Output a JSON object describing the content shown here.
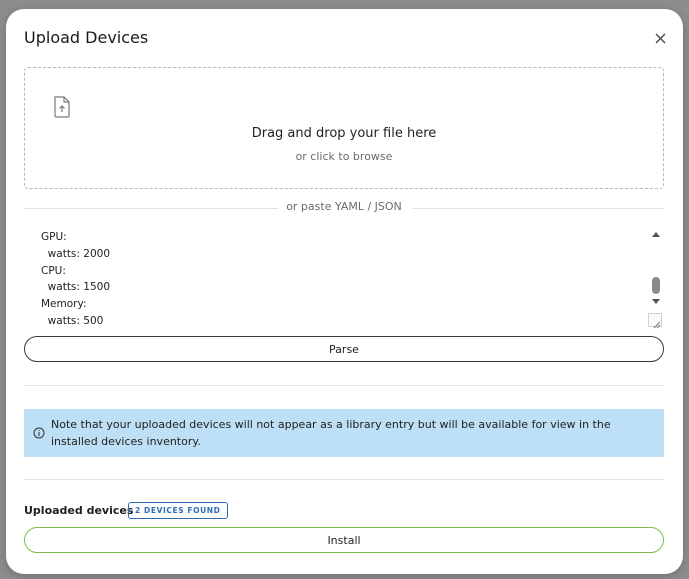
{
  "modal": {
    "title": "Upload Devices",
    "close_icon": "close-icon"
  },
  "dropzone": {
    "icon": "file-upload-icon",
    "main_text": "Drag and drop your file here",
    "sub_text": "or click to browse"
  },
  "divider": {
    "text": "or paste YAML / JSON"
  },
  "editor": {
    "lines": [
      "GPU:",
      "  watts: 2000",
      "CPU:",
      "  watts: 1500",
      "Memory:",
      "  watts: 500"
    ]
  },
  "actions": {
    "parse_label": "Parse",
    "install_label": "Install"
  },
  "notice": {
    "icon": "info-icon",
    "text": "Note that your uploaded devices will not appear as a library entry but will be available for view in the installed devices inventory."
  },
  "uploaded": {
    "label": "Uploaded devices",
    "badge": "2 DEVICES FOUND"
  },
  "colors": {
    "notice_bg": "#bde0f6",
    "badge_accent": "#2f6bb3",
    "install_border": "#7cc043"
  }
}
